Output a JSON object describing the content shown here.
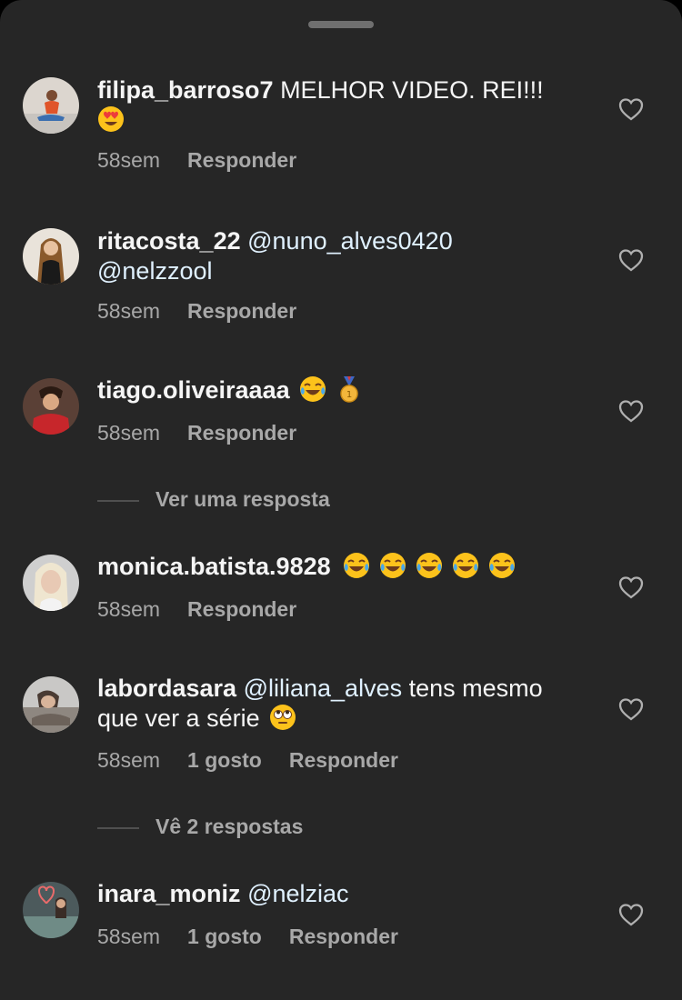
{
  "sheet": {},
  "comments": [
    {
      "username": "filipa_barroso7",
      "text": " MELHOR VIDEO. REI!!!",
      "emoji": [
        "heart-eyes"
      ],
      "time": "58sem",
      "likes": "",
      "reply_label": "Responder"
    },
    {
      "username": "ritacosta_22",
      "mention1": "@nuno_alves0420",
      "mention2": "@nelzzool",
      "time": "58sem",
      "likes": "",
      "reply_label": "Responder"
    },
    {
      "username": "tiago.oliveiraaaa",
      "emoji": [
        "tears-of-joy",
        "first-place-medal"
      ],
      "time": "58sem",
      "likes": "",
      "reply_label": "Responder",
      "replies_toggle": "Ver uma resposta"
    },
    {
      "username": "monica.batista.9828",
      "emoji": [
        "tears-of-joy",
        "tears-of-joy",
        "tears-of-joy",
        "tears-of-joy",
        "tears-of-joy"
      ],
      "time": "58sem",
      "likes": "",
      "reply_label": "Responder"
    },
    {
      "username": "labordasara",
      "mention1": "@liliana_alves",
      "text": " tens mesmo que ver a série",
      "emoji": [
        "rolling-eyes"
      ],
      "time": "58sem",
      "likes": "1 gosto",
      "reply_label": "Responder",
      "replies_toggle": "Vê 2 respostas"
    },
    {
      "username": "inara_moniz",
      "mention1": "@nelziac",
      "time": "58sem",
      "likes": "1 gosto",
      "reply_label": "Responder"
    }
  ],
  "icons": {
    "like": "heart-outline-icon",
    "grabber": "drag-handle"
  },
  "colors": {
    "background": "#262626",
    "text": "#f5f5f5",
    "secondary": "#a8a8a8",
    "mention": "#e0f1ff"
  }
}
